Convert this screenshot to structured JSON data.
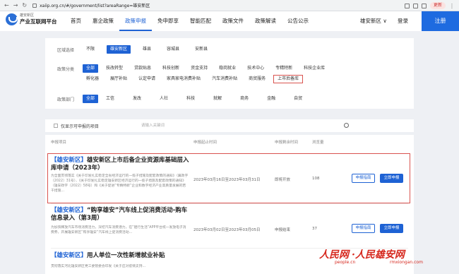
{
  "browser": {
    "url": "xaiip.org.cn/#/government/list?areaRange=雄安新区",
    "update_label": "更新",
    "menu_dots": "⋮"
  },
  "header": {
    "logo_line1": "雄安新区",
    "logo_line2": "产业互联网平台",
    "nav": [
      "首页",
      "惠企政策",
      "政策申报",
      "免申即享",
      "智能匹配",
      "政策文件",
      "政策解读",
      "公告公示"
    ],
    "active_nav_index": 2,
    "region": "雄安新区 ∨",
    "login": "登录",
    "register": "注册"
  },
  "filters": {
    "area": {
      "label": "区域选择",
      "options": [
        "不限",
        "雄安新区",
        "雄县",
        "容城县",
        "安新县"
      ],
      "selected": 1
    },
    "category": {
      "label": "政策分类",
      "row1": [
        "全部",
        "技改转型",
        "贷款贴息",
        "科技创新",
        "资金支持",
        "稳岗就业",
        "技术中心",
        "专精特新",
        "科技企业库"
      ],
      "row2": [
        "孵化器",
        "展厅补贴",
        "认定申请",
        "家具家电消费补贴",
        "汽车消费补贴",
        "商贸服务",
        "上市后备库"
      ],
      "selected": 0,
      "highlighted": "上市后备库"
    },
    "dept": {
      "label": "政策部门",
      "options": [
        "全部",
        "工信",
        "发改",
        "人社",
        "科技",
        "就解",
        "商务",
        "金融",
        "自贸"
      ],
      "selected": 0
    }
  },
  "search": {
    "checkbox_label": "仅显示可申报的项目",
    "placeholder": "请输入关键词"
  },
  "table": {
    "headers": [
      "申报项目",
      "申报起止时间",
      "申报剩余时间",
      "浏览量"
    ],
    "rows": [
      {
        "tag": "【雄安新区】",
        "title": "雄安新区上市后备企业资源库基础层入库申请（2023年）",
        "desc": "为全面贯彻落实《关于印发扎实稳定全省经济运行的一揽子措施及配套政策的通知》（冀政字〔2022〕31号）、《关于印发扎实稳定雄安新区经济运行的一揽子措施及配套政策的通知》（雄安政字〔2022〕58号）和《关于促进“专精特新”企业和数字经济产业高质量发展的若干措施…",
        "period": "2023年03月16日至2023年03月31日",
        "remaining": "即将开放",
        "views": "108",
        "guide": "申报指南",
        "apply": "立即申报"
      },
      {
        "tag": "【雄安新区】",
        "title": "“购享雄安”汽车线上促消费活动-购车信息录入（第3周）",
        "desc": "为加快释放汽车市场消费活力，深挖汽车消费潜力，在“建行生活”APP平台统一发放电子消费券，开展雄安新区“购享雄安”汽车线上促消费活动…",
        "period": "2023年03月02日至2023年03月05日",
        "remaining": "申报结束",
        "views": "37",
        "guide": "申报指南",
        "apply": "立即申报"
      },
      {
        "tag": "【雄安新区】",
        "title": "用人单位一次性新增就业补贴",
        "desc": "贯彻落实河北雄安新区党工委管委会印发《关于应对疫情支持…",
        "period": "",
        "remaining": "",
        "views": "",
        "guide": "",
        "apply": ""
      }
    ]
  },
  "watermark": {
    "text1": "人民网",
    "text2": "·人民雄安网",
    "url1": "people.cn",
    "url2": "rmxiongan.com"
  }
}
